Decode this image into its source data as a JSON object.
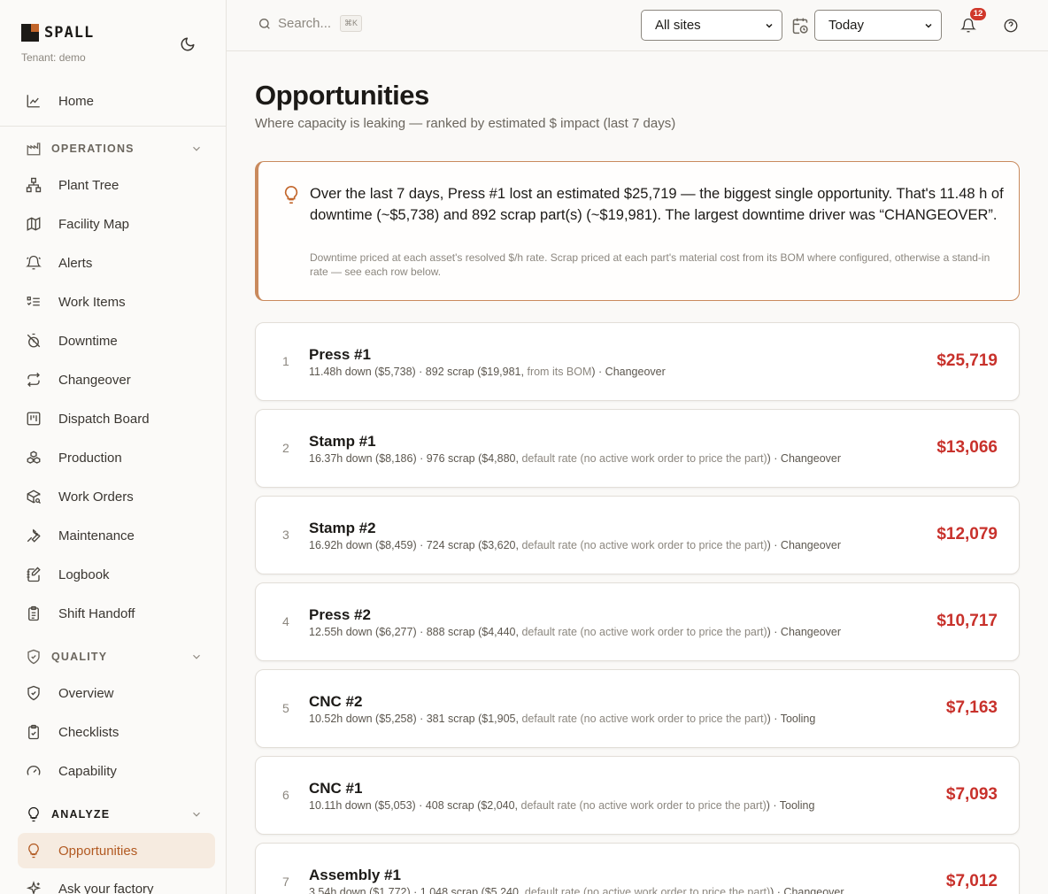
{
  "brand": {
    "name": "SPALL",
    "tenant": "Tenant: demo"
  },
  "nav": {
    "home": "Home",
    "operations": {
      "title": "OPERATIONS",
      "items": [
        "Plant Tree",
        "Facility Map",
        "Alerts",
        "Work Items",
        "Downtime",
        "Changeover",
        "Dispatch Board",
        "Production",
        "Work Orders",
        "Maintenance",
        "Logbook",
        "Shift Handoff"
      ]
    },
    "quality": {
      "title": "QUALITY",
      "items": [
        "Overview",
        "Checklists",
        "Capability"
      ]
    },
    "analyze": {
      "title": "ANALYZE",
      "items": [
        "Opportunities",
        "Ask your factory"
      ]
    }
  },
  "topbar": {
    "search_placeholder": "Search...",
    "search_shortcut": "⌘K",
    "site_select": "All sites",
    "range_select": "Today",
    "notification_count": "12"
  },
  "page": {
    "title": "Opportunities",
    "subtitle": "Where capacity is leaking — ranked by estimated $ impact (last 7 days)"
  },
  "insight": {
    "text": "Over the last 7 days, Press #1 lost an estimated $25,719 — the biggest single opportunity. That's 11.48 h of downtime (~$5,738) and 892 scrap part(s) (~$19,981). The largest downtime driver was “CHANGEOVER”.",
    "note": "Downtime priced at each asset's resolved $/h rate. Scrap priced at each part's material cost from its BOM where configured, otherwise a stand-in rate — see each row below."
  },
  "opportunities": [
    {
      "rank": "1",
      "name": "Press #1",
      "pre": "11.48h down ($5,738) · 892 scrap ($19,981, ",
      "basis": "from its BOM",
      "post": ") · Changeover",
      "amount": "$25,719"
    },
    {
      "rank": "2",
      "name": "Stamp #1",
      "pre": "16.37h down ($8,186) · 976 scrap ($4,880, ",
      "basis": "default rate (no active work order to price the part)",
      "post": ") · Changeover",
      "amount": "$13,066"
    },
    {
      "rank": "3",
      "name": "Stamp #2",
      "pre": "16.92h down ($8,459) · 724 scrap ($3,620, ",
      "basis": "default rate (no active work order to price the part)",
      "post": ") · Changeover",
      "amount": "$12,079"
    },
    {
      "rank": "4",
      "name": "Press #2",
      "pre": "12.55h down ($6,277) · 888 scrap ($4,440, ",
      "basis": "default rate (no active work order to price the part)",
      "post": ") · Changeover",
      "amount": "$10,717"
    },
    {
      "rank": "5",
      "name": "CNC #2",
      "pre": "10.52h down ($5,258) · 381 scrap ($1,905, ",
      "basis": "default rate (no active work order to price the part)",
      "post": ") · Tooling",
      "amount": "$7,163"
    },
    {
      "rank": "6",
      "name": "CNC #1",
      "pre": "10.11h down ($5,053) · 408 scrap ($2,040, ",
      "basis": "default rate (no active work order to price the part)",
      "post": ") · Tooling",
      "amount": "$7,093"
    },
    {
      "rank": "7",
      "name": "Assembly #1",
      "pre": "3.54h down ($1,772) · 1,048 scrap ($5,240, ",
      "basis": "default rate (no active work order to price the part)",
      "post": ") · Changeover",
      "amount": "$7,012"
    }
  ]
}
